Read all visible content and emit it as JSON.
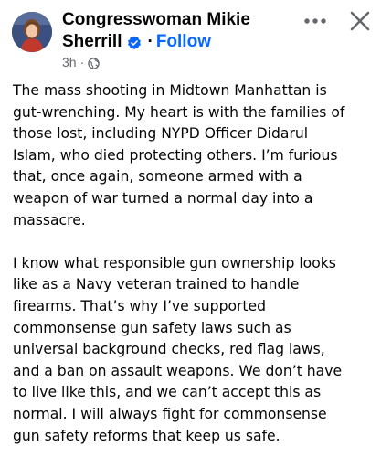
{
  "post": {
    "author_line1": "Congresswoman Mikie",
    "author_line2": "Sherrill",
    "follow_label": "Follow",
    "separator": "·",
    "timestamp": "3h",
    "audience_icon": "globe-icon",
    "more_icon": "more-horizontal-icon",
    "close_icon": "close-icon",
    "verified_icon": "verified-badge-icon",
    "paragraphs": [
      "The mass shooting in Midtown Manhattan is\ngut-wrenching. My heart is with the families of\nthose lost, including NYPD Officer Didarul\nIslam, who died protecting others. I’m furious\nthat, once again, someone armed with a\nweapon of war turned a normal day into a\nmassacre.",
      "I know what responsible gun ownership looks\nlike as a Navy veteran trained to handle\nfirearms. That’s why I’ve supported\ncommonsense gun safety laws such as\nuniversal background checks, red flag laws,\nand a ban on assault weapons. We don’t have\nto live like this, and we can’t accept this as\nnormal. I will always fight for commonsense\ngun safety reforms that keep us safe."
    ]
  },
  "colors": {
    "follow": "#0866ff",
    "verified": "#0866ff",
    "meta": "#65676b",
    "text": "#050505"
  }
}
